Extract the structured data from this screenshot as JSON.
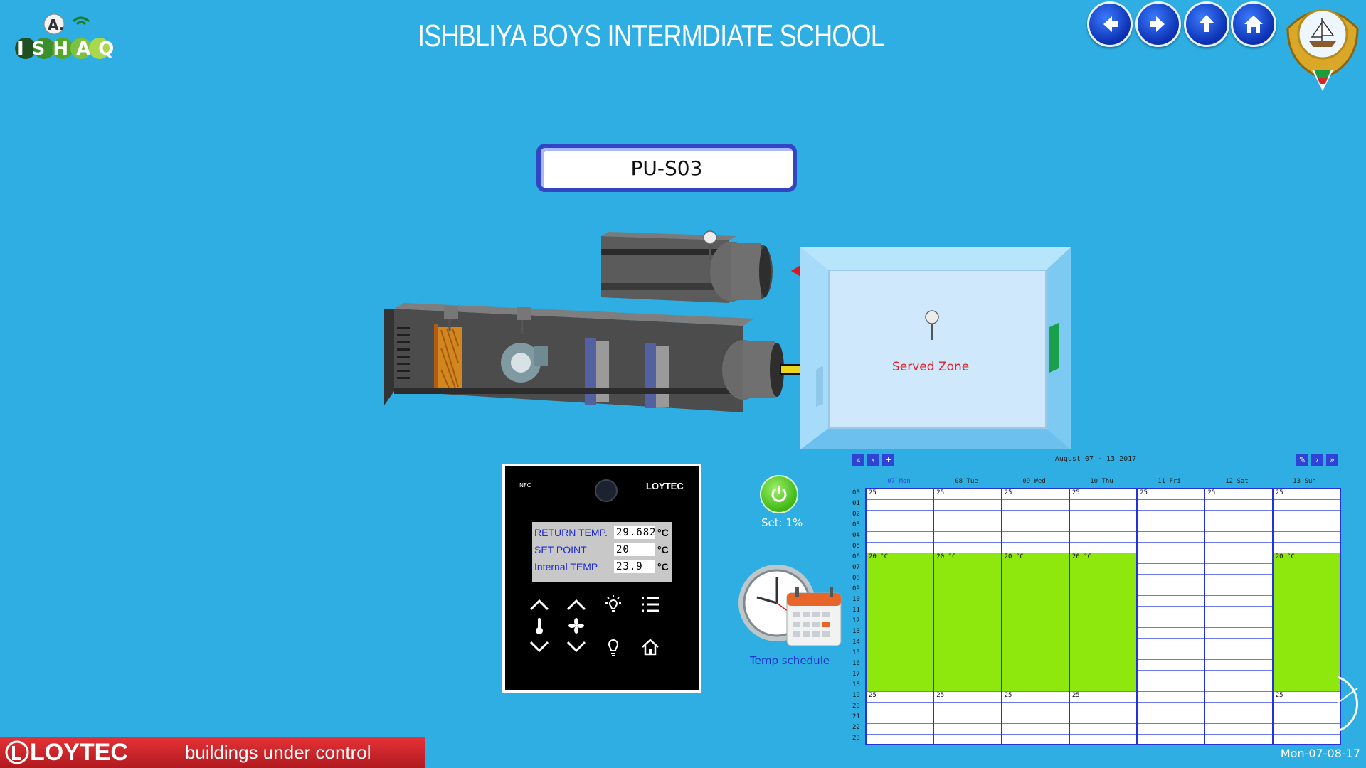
{
  "header": {
    "title": "ISHBLIYA BOYS INTERMDIATE SCHOOL",
    "logo_text": "ISHAQ",
    "logo_badge": "A."
  },
  "nav": [
    {
      "name": "back",
      "icon": "arrow-left-icon"
    },
    {
      "name": "forward",
      "icon": "arrow-right-icon"
    },
    {
      "name": "up",
      "icon": "arrow-up-icon"
    },
    {
      "name": "home",
      "icon": "home-icon"
    }
  ],
  "unit": {
    "name": "PU-S03"
  },
  "zone": {
    "label": "Served Zone"
  },
  "controller": {
    "nfc": "NFC",
    "brand": "LOYTEC",
    "readings": [
      {
        "label": "RETURN TEMP.",
        "value": "29.682",
        "unit": "°C"
      },
      {
        "label": "SET POINT",
        "value": "20",
        "unit": "°C"
      },
      {
        "label": "Internal TEMP",
        "value": "23.9",
        "unit": "°C"
      }
    ]
  },
  "power": {
    "set_text": "Set:  1%"
  },
  "schedule": {
    "label": "Temp  schedule"
  },
  "calendar": {
    "range": "August 07 - 13 2017",
    "days": [
      "07 Mon",
      "08 Tue",
      "09 Wed",
      "10 Thu",
      "11 Fri",
      "12 Sat",
      "13 Sun"
    ],
    "hours": [
      "00",
      "01",
      "02",
      "03",
      "04",
      "05",
      "06",
      "07",
      "08",
      "09",
      "10",
      "11",
      "12",
      "13",
      "14",
      "15",
      "16",
      "17",
      "18",
      "19",
      "20",
      "21",
      "22",
      "23"
    ],
    "default_value": "25",
    "comfort_value": "20 °C",
    "comfort_start_hour": 6,
    "comfort_end_hour": 19,
    "comfort_days": [
      true,
      true,
      true,
      true,
      false,
      false,
      true
    ],
    "default_label_days": [
      true,
      true,
      true,
      true,
      true,
      true,
      true
    ],
    "evening_label_days": [
      true,
      true,
      true,
      true,
      false,
      false,
      true
    ]
  },
  "footer": {
    "brand": "LOYTEC",
    "tagline": "buildings under control",
    "date": "Mon-07-08-17"
  },
  "colors": {
    "background": "#2eaee2",
    "comfort": "#8ee80d",
    "grid": "#2432d8",
    "footer": "#d6242a"
  }
}
